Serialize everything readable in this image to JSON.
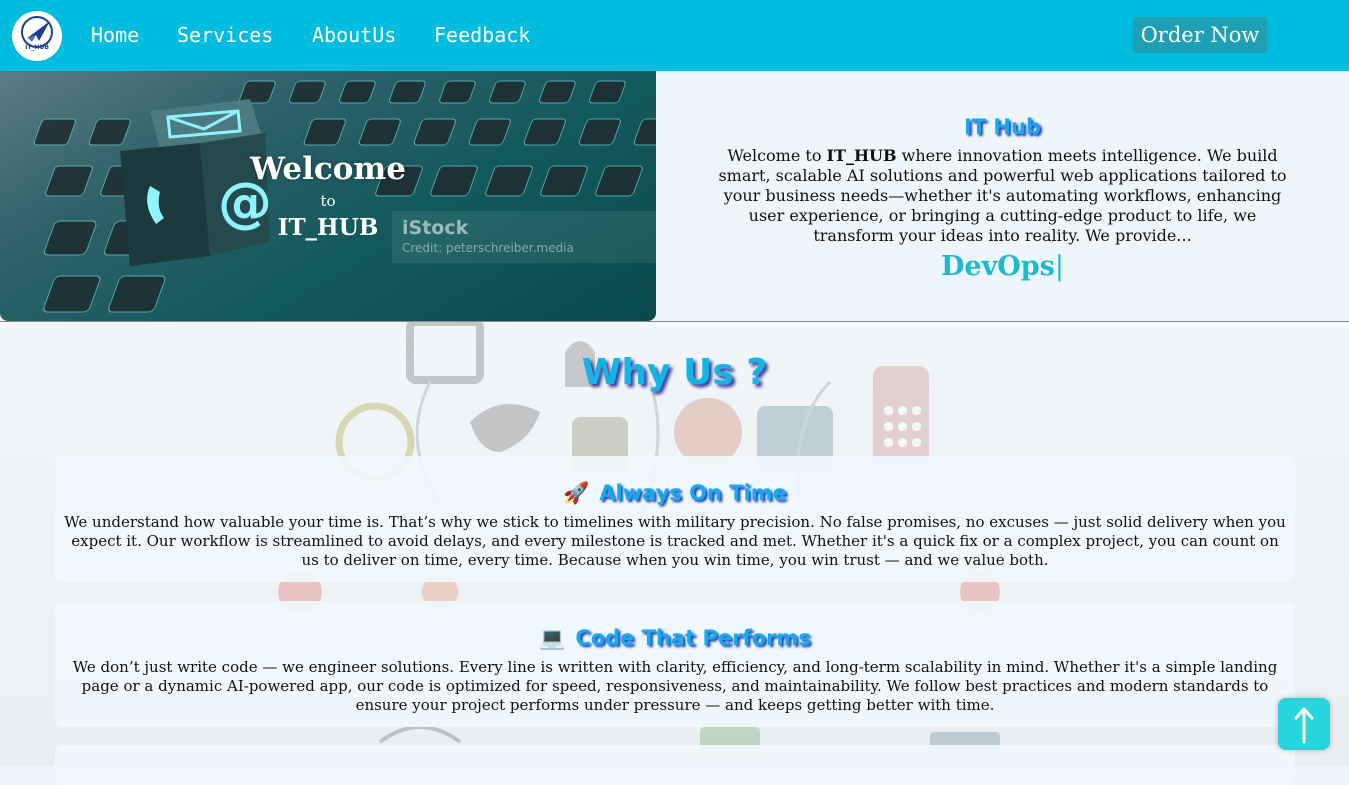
{
  "nav": {
    "logo_text": "IT_HUB",
    "links": [
      "Home",
      "Services",
      "AboutUs",
      "Feedback"
    ],
    "order_label": "Order Now"
  },
  "hero": {
    "welcome": "Welcome",
    "to": "to",
    "brand": "IT_HUB",
    "stock_label": "iStock",
    "credit": "Credit: peterschreiber.media"
  },
  "info": {
    "title": "IT Hub",
    "desc_prefix": "Welcome to ",
    "desc_brand": "IT_HUB",
    "desc_rest": " where innovation meets intelligence. We build smart, scalable AI solutions and powerful web applications tailored to your business needs—whether it's automating workflows, enhancing user experience, or bringing a cutting-edge product to life, we transform your ideas into reality. We provide...",
    "typed_word": "DevOps",
    "caret": "|"
  },
  "why": {
    "title": "Why Us ?",
    "cards": [
      {
        "icon": "🚀",
        "title": "Always On Time",
        "text": "We understand how valuable your time is. That’s why we stick to timelines with military precision. No false promises, no excuses — just solid delivery when you expect it. Our workflow is streamlined to avoid delays, and every milestone is tracked and met. Whether it's a quick fix or a complex project, you can count on us to deliver on time, every time. Because when you win time, you win trust — and we value both."
      },
      {
        "icon": "💻",
        "title": "Code That Performs",
        "text": "We don’t just write code — we engineer solutions. Every line is written with clarity, efficiency, and long-term scalability in mind. Whether it's a simple landing page or a dynamic AI-powered app, our code is optimized for speed, responsiveness, and maintainability. We follow best practices and modern standards to ensure your project performs under pressure — and keeps getting better with time."
      }
    ]
  },
  "colors": {
    "nav_bg": "#00bde0",
    "accent": "#18a9e8",
    "typed": "#1cbad2",
    "order_btn": "#1f9fb3",
    "scroll_btn": "#29d5dd"
  },
  "icons": {
    "logo": "airplane-logo-icon",
    "scroll_top": "arrow-up-icon"
  }
}
